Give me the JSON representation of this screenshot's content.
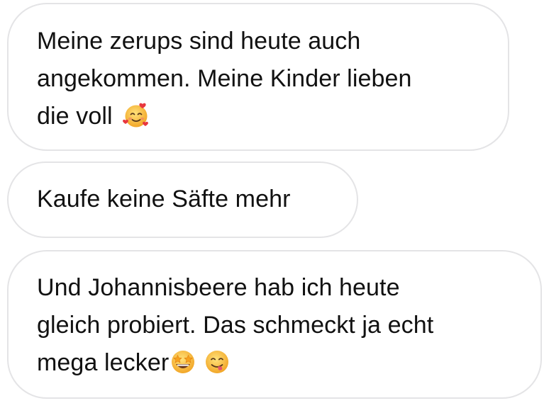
{
  "messages": [
    {
      "lines": [
        "Meine zerups sind heute auch",
        "angekommen. Meine Kinder lieben",
        "die voll"
      ],
      "emoji": [
        "smiling-face-with-hearts-icon"
      ]
    },
    {
      "lines": [
        "Kaufe keine Säfte mehr"
      ],
      "emoji": []
    },
    {
      "lines": [
        "Und Johannisbeere hab ich heute",
        "gleich probiert. Das schmeckt ja echt",
        "mega lecker"
      ],
      "emoji": [
        "star-struck-icon",
        "face-savoring-food-icon"
      ]
    }
  ],
  "colors": {
    "bubble_border": "#e4e4e6",
    "bubble_background": "#ffffff",
    "text": "#111111",
    "emoji_yellow": "#f7c23c",
    "heart_red": "#e8373f"
  }
}
